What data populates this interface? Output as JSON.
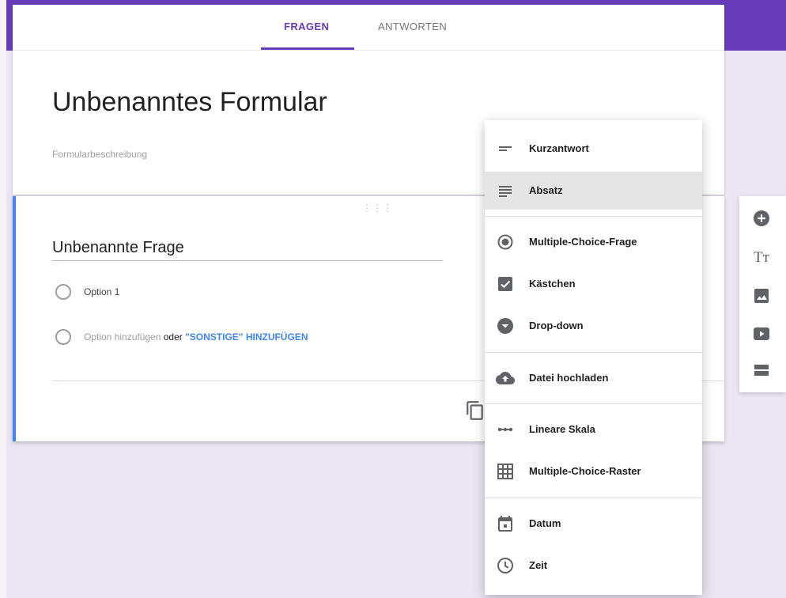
{
  "tabs": [
    {
      "label": "FRAGEN"
    },
    {
      "label": "ANTWORTEN"
    }
  ],
  "form": {
    "title": "Unbenanntes Formular",
    "description": "Formularbeschreibung"
  },
  "question": {
    "title": "Unbenannte Frage",
    "option1": "Option 1",
    "add_option": "Option hinzufügen",
    "or_word": " oder ",
    "add_other": "\"SONSTIGE\" HINZUFÜGEN"
  },
  "menu": {
    "items": [
      {
        "label": "Kurzantwort",
        "icon": "short-text-icon"
      },
      {
        "label": "Absatz",
        "icon": "paragraph-icon"
      },
      {
        "label": "Multiple-Choice-Frage",
        "icon": "radio-button-icon"
      },
      {
        "label": "Kästchen",
        "icon": "checkbox-icon"
      },
      {
        "label": "Drop-down",
        "icon": "dropdown-icon"
      },
      {
        "label": "Datei hochladen",
        "icon": "cloud-upload-icon"
      },
      {
        "label": "Lineare Skala",
        "icon": "linear-scale-icon"
      },
      {
        "label": "Multiple-Choice-Raster",
        "icon": "grid-icon"
      },
      {
        "label": "Datum",
        "icon": "calendar-icon"
      },
      {
        "label": "Zeit",
        "icon": "clock-icon"
      }
    ],
    "selected": "Absatz"
  },
  "sidebar": {
    "icons": [
      "add-circle-icon",
      "title-text-icon",
      "image-icon",
      "video-icon",
      "section-icon"
    ],
    "title_glyph": "Tт"
  },
  "colors": {
    "primary": "#673ab7",
    "accent": "#4285f4",
    "background": "#ece6f2",
    "icon": "#5f6368"
  }
}
